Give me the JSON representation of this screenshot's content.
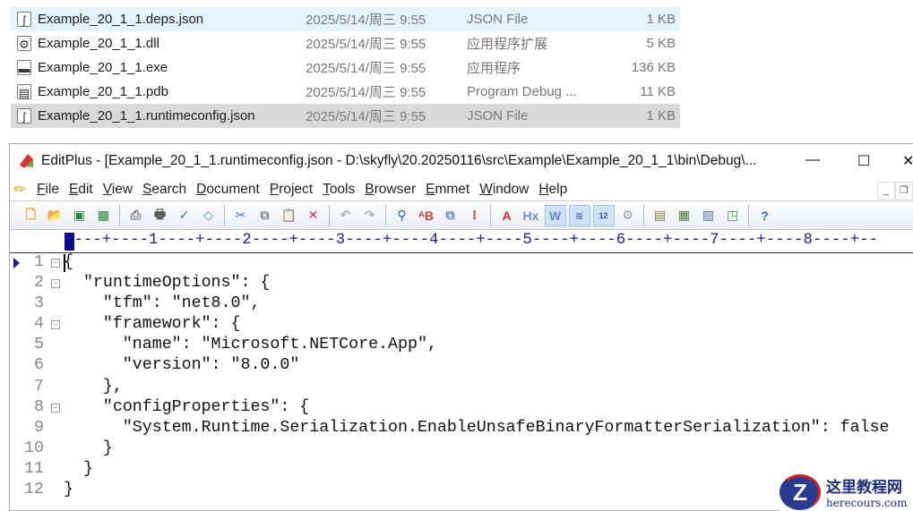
{
  "files": [
    {
      "name": "Example_20_1_1.deps.json",
      "date": "2025/5/14/周三 9:55",
      "type": "JSON File",
      "size": "1 KB",
      "icon": "json-file-icon",
      "glyph": "ʃ",
      "state": "hover"
    },
    {
      "name": "Example_20_1_1.dll",
      "date": "2025/5/14/周三 9:55",
      "type": "应用程序扩展",
      "size": "5 KB",
      "icon": "dll-file-icon",
      "glyph": "⚙",
      "state": ""
    },
    {
      "name": "Example_20_1_1.exe",
      "date": "2025/5/14/周三 9:55",
      "type": "应用程序",
      "size": "136 KB",
      "icon": "exe-file-icon",
      "glyph": "▬",
      "state": ""
    },
    {
      "name": "Example_20_1_1.pdb",
      "date": "2025/5/14/周三 9:55",
      "type": "Program Debug ...",
      "size": "11 KB",
      "icon": "pdb-file-icon",
      "glyph": "▤",
      "state": ""
    },
    {
      "name": "Example_20_1_1.runtimeconfig.json",
      "date": "2025/5/14/周三 9:55",
      "type": "JSON File",
      "size": "1 KB",
      "icon": "json-file-icon",
      "glyph": "ʃ",
      "state": "selected"
    }
  ],
  "editor": {
    "title": "EditPlus - [Example_20_1_1.runtimeconfig.json - D:\\skyfly\\20.20250116\\src\\Example\\Example_20_1_1\\bin\\Debug\\...",
    "menu": [
      "File",
      "Edit",
      "View",
      "Search",
      "Document",
      "Project",
      "Tools",
      "Browser",
      "Emmet",
      "Window",
      "Help"
    ],
    "ruler": "----+----1----+----2----+----3----+----4----+----5----+----6----+----7----+----8----+--",
    "lines": [
      {
        "n": "1",
        "fold": true,
        "text": "{"
      },
      {
        "n": "2",
        "fold": true,
        "text": "  \"runtimeOptions\": {"
      },
      {
        "n": "3",
        "fold": false,
        "text": "    \"tfm\": \"net8.0\","
      },
      {
        "n": "4",
        "fold": true,
        "text": "    \"framework\": {"
      },
      {
        "n": "5",
        "fold": false,
        "text": "      \"name\": \"Microsoft.NETCore.App\","
      },
      {
        "n": "6",
        "fold": false,
        "text": "      \"version\": \"8.0.0\""
      },
      {
        "n": "7",
        "fold": false,
        "text": "    },"
      },
      {
        "n": "8",
        "fold": true,
        "text": "    \"configProperties\": {"
      },
      {
        "n": "9",
        "fold": false,
        "text": "      \"System.Runtime.Serialization.EnableUnsafeBinaryFormatterSerialization\": false"
      },
      {
        "n": "10",
        "fold": false,
        "text": "    }"
      },
      {
        "n": "11",
        "fold": false,
        "text": "  }"
      },
      {
        "n": "12",
        "fold": false,
        "text": "}"
      }
    ]
  },
  "watermark": {
    "cn": "这里教程网",
    "en": "herecours.com"
  }
}
